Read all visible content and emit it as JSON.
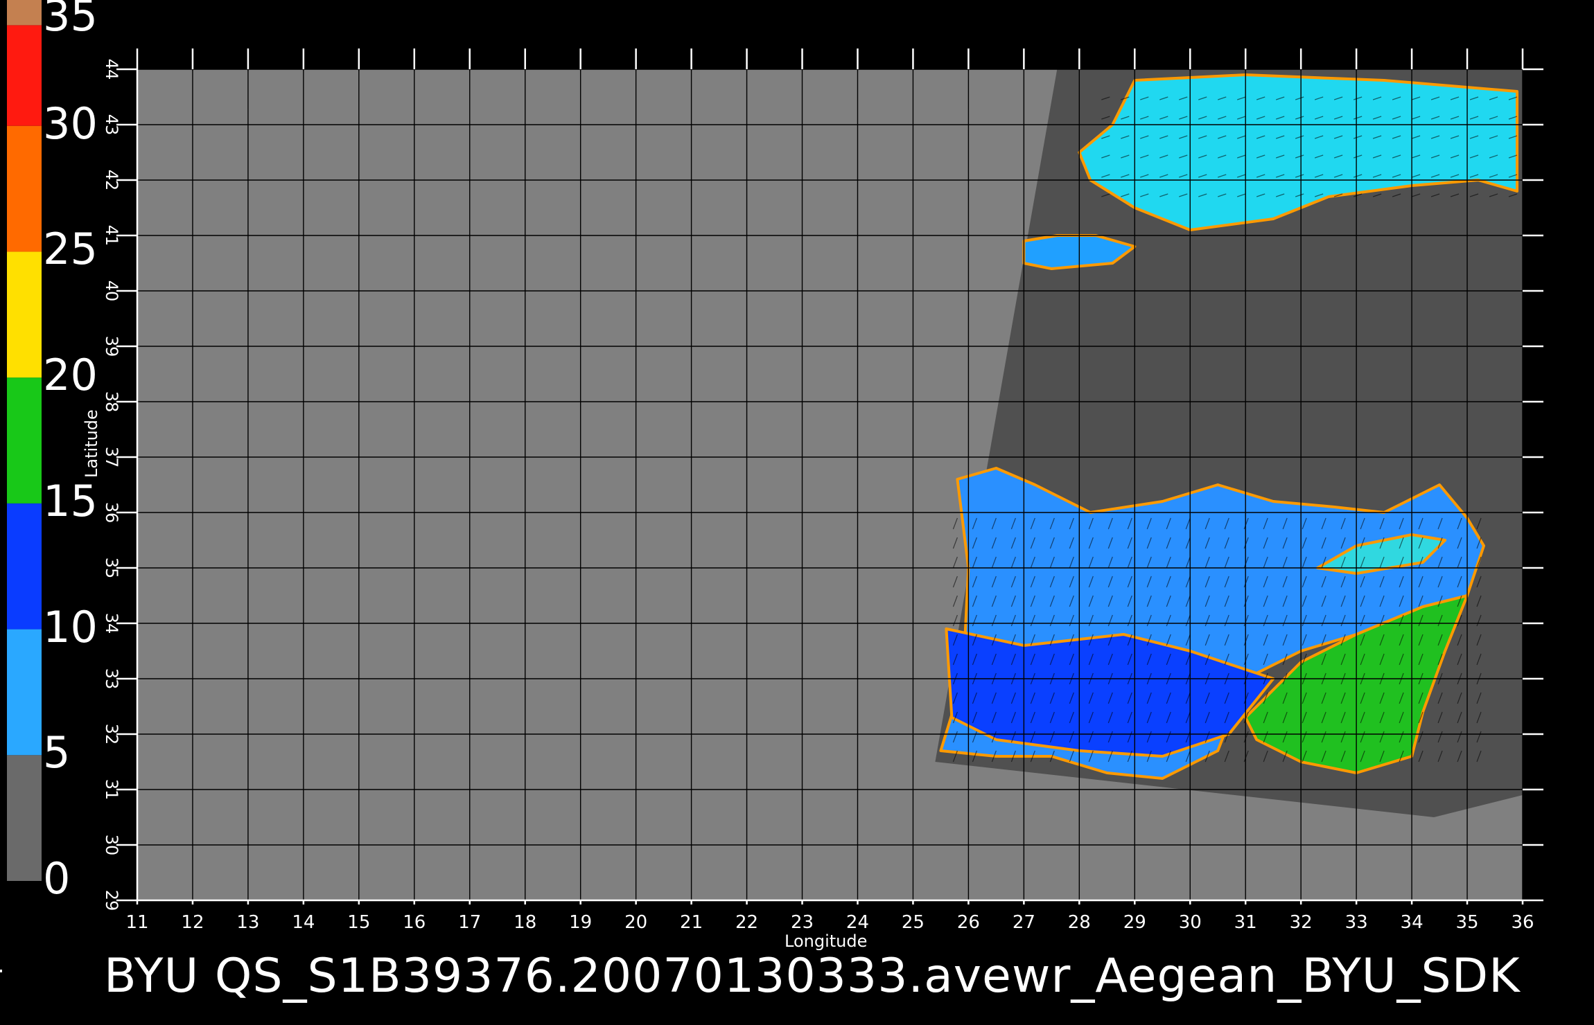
{
  "title": "BYU  QS_S1B39376.20070130333.avewr_Aegean_BYU_SDK",
  "colors": {
    "land": "#808080",
    "swath_background": "#505050",
    "grid": "#000000",
    "frame": "#ffffff"
  },
  "chart_data": {
    "type": "heatmap",
    "xlabel": "Longitude",
    "ylabel": "Latitude",
    "xlim": [
      11,
      36
    ],
    "ylim": [
      29,
      44
    ],
    "x_ticks": [
      11,
      12,
      13,
      14,
      15,
      16,
      17,
      18,
      19,
      20,
      21,
      22,
      23,
      24,
      25,
      26,
      27,
      28,
      29,
      30,
      31,
      32,
      33,
      34,
      35,
      36
    ],
    "y_ticks": [
      29,
      30,
      31,
      32,
      33,
      34,
      35,
      36,
      37,
      38,
      39,
      40,
      41,
      42,
      43,
      44
    ],
    "grid": true,
    "colorbar": {
      "placement": "left",
      "range": [
        0,
        35
      ],
      "tick_labels": [
        "35",
        "30",
        "25",
        "20",
        "15",
        "10",
        "5",
        "0"
      ],
      "tick_values": [
        35,
        30,
        25,
        20,
        15,
        10,
        5,
        0
      ],
      "bands": [
        {
          "from": 0,
          "to": 5,
          "color": "#6a6a6a"
        },
        {
          "from": 5,
          "to": 10,
          "color": "#2aa8ff"
        },
        {
          "from": 10,
          "to": 15,
          "color": "#0a3cff"
        },
        {
          "from": 15,
          "to": 20,
          "color": "#18c818"
        },
        {
          "from": 20,
          "to": 25,
          "color": "#ffe000"
        },
        {
          "from": 25,
          "to": 30,
          "color": "#ff6a00"
        },
        {
          "from": 30,
          "to": 34,
          "color": "#ff1a10"
        },
        {
          "from": 34,
          "to": 35,
          "color": "#c48050"
        }
      ]
    },
    "swath_corners_lonlat": [
      [
        27.6,
        44.0
      ],
      [
        36.0,
        44.0
      ],
      [
        36.0,
        30.9
      ],
      [
        34.4,
        30.5
      ],
      [
        25.4,
        31.5
      ]
    ],
    "wind_regions": [
      {
        "name": "black-sea",
        "color": "#20d8f0",
        "polygon": [
          [
            28.0,
            42.5
          ],
          [
            28.6,
            43.0
          ],
          [
            29.0,
            43.8
          ],
          [
            31.0,
            43.9
          ],
          [
            33.5,
            43.8
          ],
          [
            35.9,
            43.6
          ],
          [
            35.9,
            41.8
          ],
          [
            35.2,
            42.0
          ],
          [
            34.0,
            41.9
          ],
          [
            32.5,
            41.7
          ],
          [
            31.5,
            41.3
          ],
          [
            30.0,
            41.1
          ],
          [
            29.0,
            41.5
          ],
          [
            28.2,
            42.0
          ]
        ]
      },
      {
        "name": "marmara",
        "color": "#20a0ff",
        "polygon": [
          [
            27.0,
            40.9
          ],
          [
            27.6,
            41.0
          ],
          [
            28.3,
            41.0
          ],
          [
            29.0,
            40.8
          ],
          [
            28.6,
            40.5
          ],
          [
            27.5,
            40.4
          ],
          [
            27.0,
            40.5
          ]
        ]
      },
      {
        "name": "mediterranean-west",
        "color": "#2a90ff",
        "polygon": [
          [
            25.8,
            36.6
          ],
          [
            26.5,
            36.8
          ],
          [
            27.2,
            36.5
          ],
          [
            28.2,
            36.0
          ],
          [
            29.5,
            36.2
          ],
          [
            30.5,
            36.5
          ],
          [
            31.5,
            36.2
          ],
          [
            32.6,
            36.1
          ],
          [
            33.5,
            36.0
          ],
          [
            34.5,
            36.5
          ],
          [
            35.0,
            35.9
          ],
          [
            35.3,
            35.4
          ],
          [
            35.0,
            34.5
          ],
          [
            34.5,
            34.0
          ],
          [
            33.0,
            33.8
          ],
          [
            32.0,
            33.5
          ],
          [
            31.0,
            33.0
          ],
          [
            30.5,
            31.7
          ],
          [
            29.5,
            31.2
          ],
          [
            28.5,
            31.3
          ],
          [
            27.5,
            31.6
          ],
          [
            26.5,
            31.6
          ],
          [
            25.5,
            31.7
          ],
          [
            25.9,
            33.0
          ],
          [
            26.0,
            35.0
          ]
        ]
      },
      {
        "name": "mediterranean-core",
        "color": "#0a40ff",
        "polygon": [
          [
            25.6,
            33.9
          ],
          [
            27.0,
            33.6
          ],
          [
            28.8,
            33.8
          ],
          [
            30.0,
            33.5
          ],
          [
            31.5,
            33.0
          ],
          [
            30.7,
            32.0
          ],
          [
            29.5,
            31.6
          ],
          [
            28.0,
            31.7
          ],
          [
            26.5,
            31.9
          ],
          [
            25.7,
            32.3
          ]
        ]
      },
      {
        "name": "levant-green",
        "color": "#20c020",
        "polygon": [
          [
            31.0,
            32.3
          ],
          [
            32.0,
            33.3
          ],
          [
            33.0,
            33.8
          ],
          [
            34.2,
            34.3
          ],
          [
            35.0,
            34.5
          ],
          [
            34.6,
            33.5
          ],
          [
            34.2,
            32.4
          ],
          [
            34.0,
            31.6
          ],
          [
            33.0,
            31.3
          ],
          [
            32.0,
            31.5
          ],
          [
            31.2,
            31.9
          ]
        ]
      },
      {
        "name": "cyprus-surroundings",
        "color": "#30d8e0",
        "polygon": [
          [
            32.3,
            35.0
          ],
          [
            33.0,
            35.4
          ],
          [
            34.0,
            35.6
          ],
          [
            34.6,
            35.5
          ],
          [
            34.2,
            35.1
          ],
          [
            33.0,
            34.9
          ]
        ]
      }
    ]
  }
}
